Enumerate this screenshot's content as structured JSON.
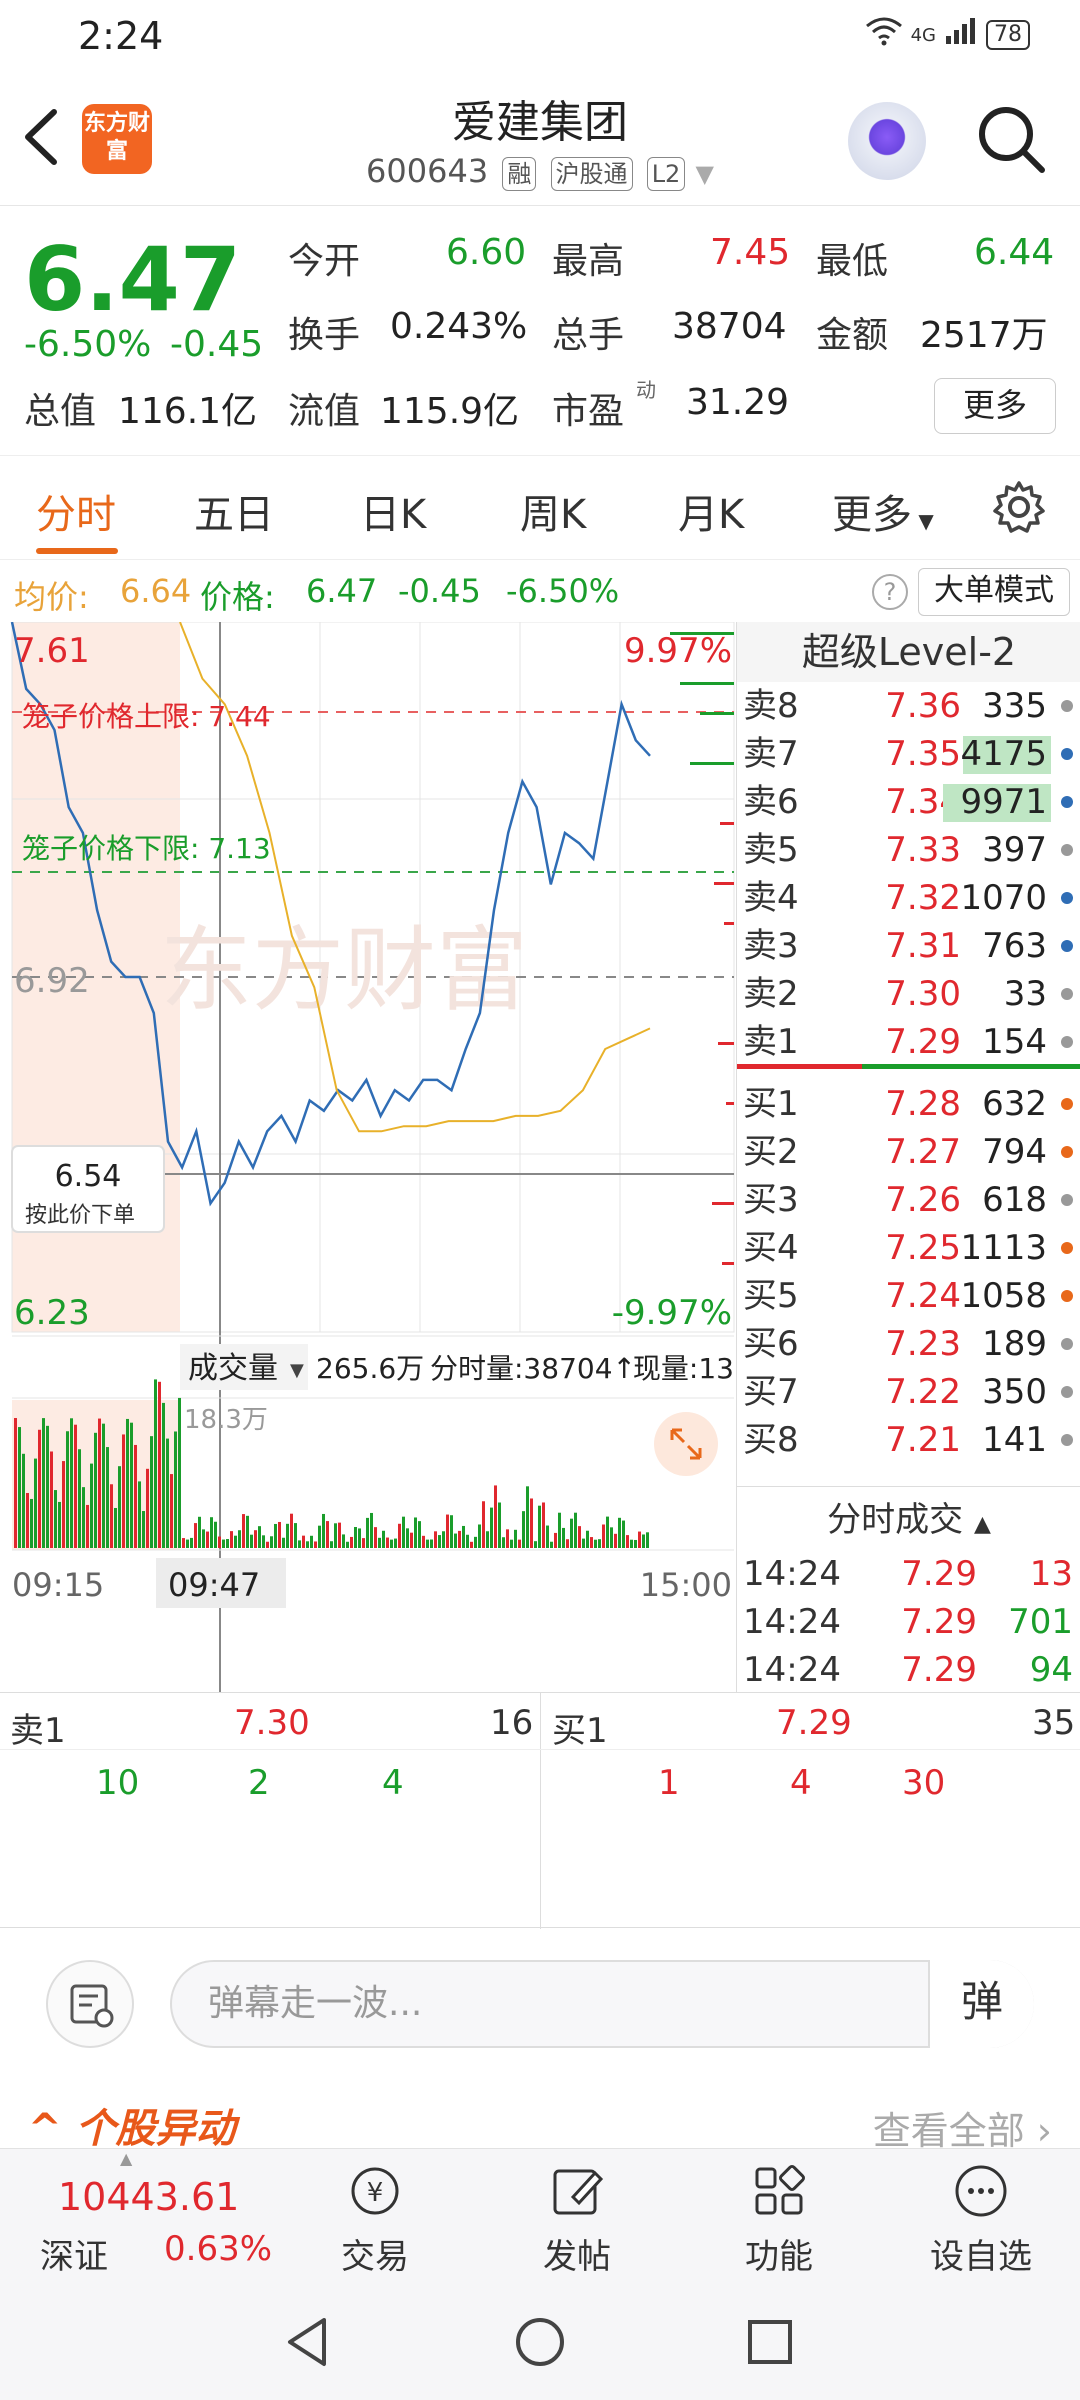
{
  "status_bar": {
    "time": "2:24",
    "network": "4G",
    "battery": "78"
  },
  "header": {
    "logo_text": "东方财富",
    "stock_name": "爱建集团",
    "stock_code": "600643",
    "tags": [
      "融",
      "沪股通",
      "L2"
    ]
  },
  "quote": {
    "price": "6.47",
    "change_pct": "-6.50%",
    "change_amt": "-0.45",
    "open_label": "今开",
    "open": "6.60",
    "high_label": "最高",
    "high": "7.45",
    "low_label": "最低",
    "low": "6.44",
    "turnover_label": "换手",
    "turnover": "0.243%",
    "volume_label": "总手",
    "volume": "38704",
    "amount_label": "金额",
    "amount": "2517万",
    "mktcap_label": "总值",
    "mktcap": "116.1亿",
    "float_label": "流值",
    "float_cap": "115.9亿",
    "pe_label": "市盈",
    "pe_sup": "动",
    "pe": "31.29",
    "more_label": "更多"
  },
  "tabs": [
    "分时",
    "五日",
    "日K",
    "周K",
    "月K",
    "更多"
  ],
  "avg_row": {
    "avg_label": "均价:",
    "avg_value": "6.64",
    "price_label": "价格:",
    "price_value": "6.47",
    "change_amt": "-0.45",
    "change_pct": "-6.50%",
    "big_order_label": "大单模式"
  },
  "chart": {
    "top_price": "7.61",
    "top_pct": "9.97%",
    "mid_price": "6.92",
    "bottom_price": "6.23",
    "bottom_pct": "-9.97%",
    "cage_upper": "笼子价格上限: 7.44",
    "cage_lower": "笼子价格下限: 7.13",
    "watermark": "东方财富",
    "cursor_price": "6.54",
    "cursor_action": "按此价下单",
    "vol_label": "成交量",
    "vol_value": "265.6万",
    "time_vol": "分时量:38704↑",
    "now_vol": "现量:13",
    "vol_max": "18.3万",
    "t_start": "09:15",
    "t_cursor": "09:47",
    "t_end": "15:00"
  },
  "chart_data": {
    "type": "line",
    "title": "",
    "ylim": [
      6.23,
      7.61
    ],
    "x_range": [
      "09:15",
      "15:00"
    ],
    "series": [
      {
        "values": [
          7.61,
          7.48,
          7.45,
          7.4,
          7.25,
          7.2,
          7.05,
          6.95,
          6.92,
          6.92,
          6.85,
          6.6,
          6.55,
          6.62,
          6.48,
          6.52,
          6.6,
          6.55,
          6.62,
          6.65,
          6.6,
          6.68,
          6.66,
          6.7,
          6.68,
          6.72,
          6.65,
          6.7,
          6.68,
          6.72,
          6.72,
          6.7,
          6.78,
          6.85,
          7.05,
          7.2,
          7.3,
          7.25,
          7.1,
          7.2,
          7.18,
          7.15,
          7.3,
          7.45,
          7.38,
          7.35
        ]
      },
      {
        "values": [
          7.61,
          7.5,
          7.45,
          7.35,
          7.2,
          7.0,
          6.9,
          6.7,
          6.62,
          6.62,
          6.63,
          6.63,
          6.64,
          6.64,
          6.64,
          6.65,
          6.65,
          6.66,
          6.7,
          6.78,
          6.8,
          6.82
        ]
      }
    ],
    "volume": {
      "max": "18.3万"
    }
  },
  "order_book": {
    "title": "超级Level-2",
    "asks": [
      {
        "label": "卖8",
        "price": "7.36",
        "vol": "335"
      },
      {
        "label": "卖7",
        "price": "7.35",
        "vol": "4175"
      },
      {
        "label": "卖6",
        "price": "7.34",
        "vol": "9971"
      },
      {
        "label": "卖5",
        "price": "7.33",
        "vol": "397"
      },
      {
        "label": "卖4",
        "price": "7.32",
        "vol": "1070"
      },
      {
        "label": "卖3",
        "price": "7.31",
        "vol": "763"
      },
      {
        "label": "卖2",
        "price": "7.30",
        "vol": "33"
      },
      {
        "label": "卖1",
        "price": "7.29",
        "vol": "154"
      }
    ],
    "bids": [
      {
        "label": "买1",
        "price": "7.28",
        "vol": "632"
      },
      {
        "label": "买2",
        "price": "7.27",
        "vol": "794"
      },
      {
        "label": "买3",
        "price": "7.26",
        "vol": "618"
      },
      {
        "label": "买4",
        "price": "7.25",
        "vol": "1113"
      },
      {
        "label": "买5",
        "price": "7.24",
        "vol": "1058"
      },
      {
        "label": "买6",
        "price": "7.23",
        "vol": "189"
      },
      {
        "label": "买7",
        "price": "7.22",
        "vol": "350"
      },
      {
        "label": "买8",
        "price": "7.21",
        "vol": "141"
      }
    ],
    "ticks_title": "分时成交",
    "ticks": [
      {
        "time": "14:24",
        "price": "7.29",
        "vol": "13"
      },
      {
        "time": "14:24",
        "price": "7.29",
        "vol": "701"
      },
      {
        "time": "14:24",
        "price": "7.29",
        "vol": "94"
      }
    ]
  },
  "bidask": {
    "sell_label": "卖1",
    "sell_price": "7.30",
    "sell_total": "16",
    "sell_orders": [
      "10",
      "2",
      "4"
    ],
    "buy_label": "买1",
    "buy_price": "7.29",
    "buy_total": "35",
    "buy_orders": [
      "1",
      "4",
      "30"
    ]
  },
  "danmaku": {
    "placeholder": "弹幕走一波...",
    "send": "弹"
  },
  "stock_move": {
    "title": "个股异动",
    "view_all": "查看全部"
  },
  "bottom_nav": {
    "index_value": "10443.61",
    "index_name": "深证",
    "index_pct": "0.63%",
    "items": [
      "交易",
      "发帖",
      "功能",
      "设自选"
    ]
  }
}
